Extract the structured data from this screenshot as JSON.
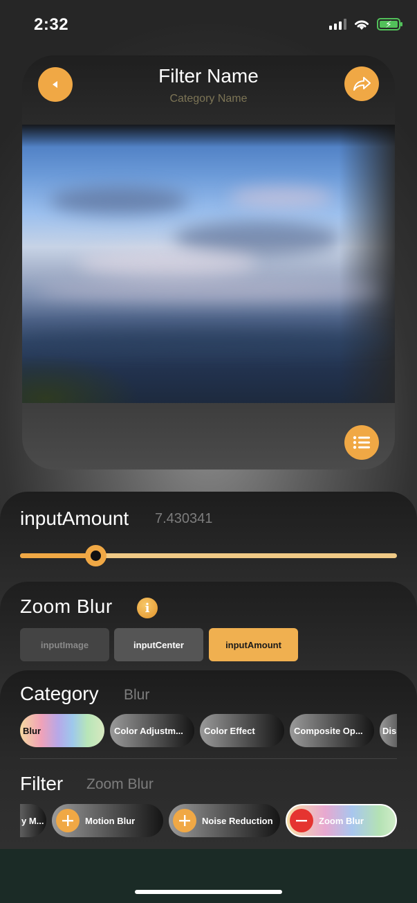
{
  "status_bar": {
    "time": "2:32"
  },
  "preview": {
    "title": "Filter Name",
    "subtitle": "Category Name",
    "icons": {
      "back": "back-arrow-icon",
      "share": "share-icon",
      "list": "list-icon"
    }
  },
  "parameter": {
    "name": "inputAmount",
    "value": "7.430341",
    "slider_fraction": 0.2
  },
  "filter_info": {
    "name": "Zoom Blur",
    "info_symbol": "i",
    "inputs": [
      "inputImage",
      "inputCenter",
      "inputAmount"
    ],
    "selected_input": "inputAmount"
  },
  "category": {
    "label": "Category",
    "value": "Blur",
    "items": [
      "Blur",
      "Color Adjustm...",
      "Color Effect",
      "Composite Op...",
      "Dis"
    ]
  },
  "filter": {
    "label": "Filter",
    "value": "Zoom Blur",
    "items": [
      "y M...",
      "Motion Blur",
      "Noise Reduction",
      "Zoom Blur"
    ]
  },
  "colors": {
    "accent": "#f0a845",
    "remove": "#e53430",
    "battery": "#52c05a"
  }
}
